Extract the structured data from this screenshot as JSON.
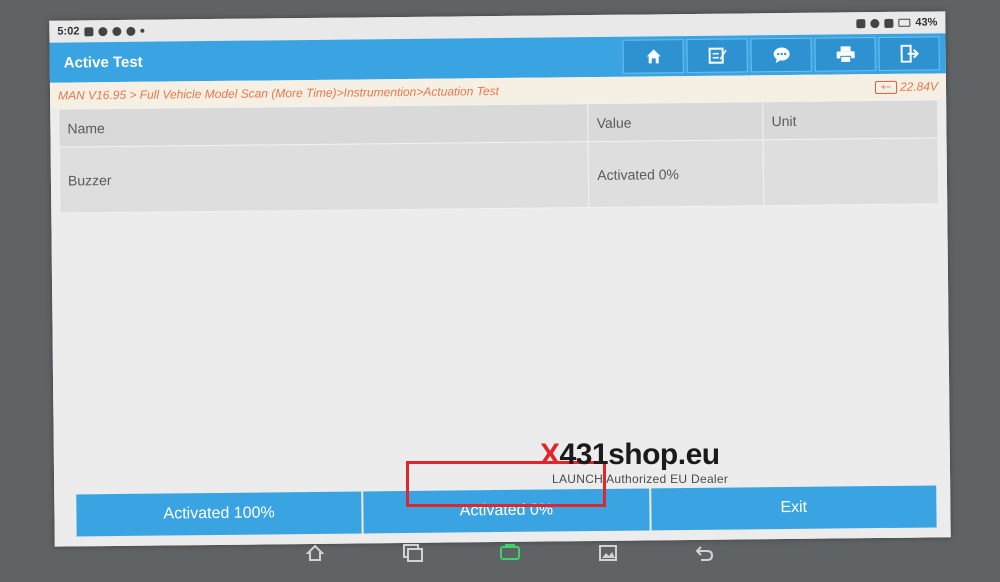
{
  "status_bar": {
    "time": "5:02",
    "battery": "43%"
  },
  "header": {
    "title": "Active Test",
    "buttons": [
      {
        "name": "home-icon"
      },
      {
        "name": "report-icon"
      },
      {
        "name": "chat-icon"
      },
      {
        "name": "print-icon"
      },
      {
        "name": "exit-icon"
      }
    ]
  },
  "breadcrumb": {
    "path": "MAN V16.95 > Full Vehicle Model Scan (More Time)>Instrumention>Actuation Test",
    "voltage": "22.84V",
    "battery_symbol": "+−"
  },
  "table": {
    "columns": [
      "Name",
      "Value",
      "Unit"
    ],
    "rows": [
      {
        "name": "Buzzer",
        "value": "Activated 0%",
        "unit": ""
      }
    ]
  },
  "actions": {
    "btn1": "Activated 100%",
    "btn2": "Activated 0%",
    "btn3": "Exit"
  },
  "watermark": {
    "x": "X",
    "rest": "431shop.eu",
    "tagline": "LAUNCH Authorized EU Dealer"
  },
  "colors": {
    "accent": "#3aa4e3",
    "breadcrumb": "#e8794a",
    "highlight": "#e0262a"
  }
}
